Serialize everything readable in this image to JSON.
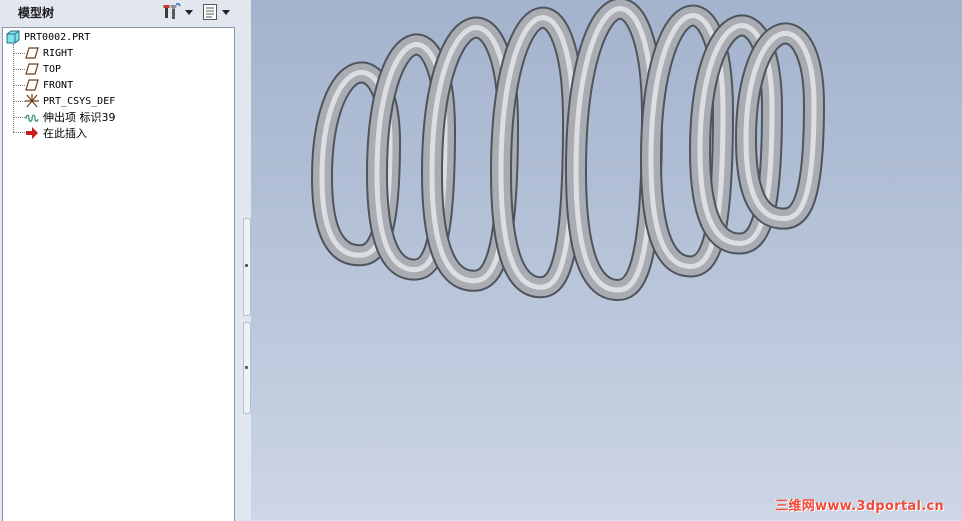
{
  "panel": {
    "title": "模型树",
    "settings_icon": "tools-icon",
    "show_icon": "document-list-icon"
  },
  "tree": {
    "root": {
      "label": "PRT0002.PRT",
      "icon": "part-icon"
    },
    "items": [
      {
        "label": "RIGHT",
        "icon": "datum-plane-icon"
      },
      {
        "label": "TOP",
        "icon": "datum-plane-icon"
      },
      {
        "label": "FRONT",
        "icon": "datum-plane-icon"
      },
      {
        "label": "PRT_CSYS_DEF",
        "icon": "coordinate-system-icon"
      },
      {
        "label": "伸出项 标识39",
        "icon": "helical-sweep-icon"
      },
      {
        "label": "在此插入",
        "icon": "insert-here-arrow-icon"
      }
    ]
  },
  "viewport": {
    "model": "spring",
    "background_top": "#a4b3cd",
    "background_bottom": "#cdd6e5",
    "spring_color": "#a9adb3"
  },
  "watermark": "三维网www.3dportal.cn"
}
